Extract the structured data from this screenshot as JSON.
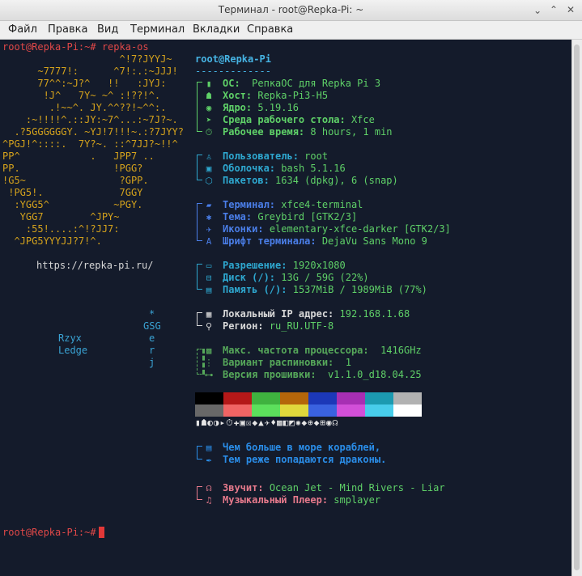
{
  "window": {
    "title": "Терминал - root@Repka-Pi: ~",
    "minimize": "⌃",
    "maximize": "⌃",
    "close": "✕"
  },
  "menu": [
    "Файл",
    "Правка",
    "Вид",
    "Терминал",
    "Вкладки",
    "Справка"
  ],
  "prompt": "root@Repka-Pi:~#",
  "command": "repka-os",
  "ascii_art": [
    "                    ^!7?JYYJ~",
    "      ~7777!:      ^7!:.:~JJJ!",
    "      77^^:~J?^   !!   :JYJ:",
    "       !J^   7Y~ ~^ :!??!^.",
    "        .!~~^. JY.^^??!~^^:.",
    "    :~!!!!^.::JY:~7^...:~7J?~.",
    "  .?5GGGGGGY. ~YJ!7!!!~.:?7JYY?",
    "^PGJ!^::::.  7Y?~. ::^7JJ?~!!^",
    "PP^            .   JPP7 ..",
    "PP.                !PGG?",
    "!G5~                ?GPP.",
    " !PG5!.             7GGY",
    "  :YGG5^           ~PGY.",
    "   YGG7        ^JPY~",
    "    :55!....:^!?JJ7:",
    "  ^JPG5YYYJJ?7!^."
  ],
  "url": "https://repka-pi.ru/",
  "left_labels": [
    "Rzyx",
    "Ledge"
  ],
  "left_vertical": [
    "*",
    "GSG",
    "e",
    "r",
    "j"
  ],
  "user_host": "root@Repka-Pi",
  "separator": "-------------",
  "groups": {
    "os": [
      {
        "label": "ОС:",
        "value": "РепкаОС для Repka Pi 3",
        "icon": "hdd-icon"
      },
      {
        "label": "Хост:",
        "value": "Repka-Pi3-H5",
        "icon": "penguin-icon"
      },
      {
        "label": "Ядро:",
        "value": "5.19.16",
        "icon": "kernel-icon"
      },
      {
        "label": "Среда рабочего стола:",
        "value": "Xfce",
        "icon": "mouse-icon"
      },
      {
        "label": "Рабочее время:",
        "value": "8 hours, 1 min",
        "icon": "timer-icon"
      }
    ],
    "user": [
      {
        "label": "Пользователь:",
        "value": "root",
        "icon": "user-icon"
      },
      {
        "label": "Оболочка:",
        "value": "bash 5.1.16",
        "icon": "shell-icon"
      },
      {
        "label": "Пакетов:",
        "value": "1634 (dpkg), 6 (snap)",
        "icon": "package-icon"
      }
    ],
    "term": [
      {
        "label": "Терминал:",
        "value": "xfce4-terminal",
        "icon": "terminal-icon"
      },
      {
        "label": "Тема:",
        "value": "Greybird [GTK2/3]",
        "icon": "theme-icon"
      },
      {
        "label": "Иконки:",
        "value": "elementary-xfce-darker [GTK2/3]",
        "icon": "icons-icon"
      },
      {
        "label": "Шрифт терминала:",
        "value": "DejaVu Sans Mono 9",
        "icon": "font-icon"
      }
    ],
    "disp": [
      {
        "label": "Разрешение:",
        "value": "1920x1080",
        "icon": "monitor-icon"
      },
      {
        "label": "Диск (/):",
        "value": "13G / 59G (22%)",
        "icon": "disk-icon"
      },
      {
        "label": "Память (/):",
        "value": "1537MiB / 1989MiB (77%)",
        "icon": "memory-icon"
      }
    ],
    "net": [
      {
        "label": "Локальный IP адрес:",
        "value": "192.168.1.68",
        "icon": "ip-icon"
      },
      {
        "label": "Регион:",
        "value": "ru_RU.UTF-8",
        "icon": "location-icon"
      }
    ],
    "cpu": [
      {
        "label": "Макс. частота процессора:",
        "value": " 1416GHz",
        "icon": "cpu-icon"
      },
      {
        "label": "Вариант распиновки:",
        "value": " 1",
        "icon": "pinout-icon"
      },
      {
        "label": "Версия прошивки:",
        "value": " v1.1.0_d18.04.25",
        "icon": "firmware-icon"
      }
    ],
    "quote": [
      {
        "label": "Чем больше в море кораблей,",
        "value": "",
        "icon": "scroll-icon"
      },
      {
        "label": "Тем реже попадаются драконы.",
        "value": "",
        "icon": "quill-icon"
      }
    ],
    "music": [
      {
        "label": "Звучит:",
        "value": "Ocean Jet - Mind Rivers - Liar",
        "icon": "headphones-icon"
      },
      {
        "label": "Музыкальный Плеер:",
        "value": "smplayer",
        "icon": "note-icon"
      }
    ]
  },
  "palette": {
    "row1": [
      "#000000",
      "#b41818",
      "#3fb23f",
      "#b4660a",
      "#1c38b8",
      "#a72fb3",
      "#1c9ab0",
      "#b2b2b2"
    ],
    "row2": [
      "#686868",
      "#f06464",
      "#5ce05c",
      "#e0d83c",
      "#3a62e0",
      "#d24fd8",
      "#48cdea",
      "#ffffff"
    ]
  },
  "icon_strip": "▮☗◐◑▸⏱✚▣☒◆▲✈♦▩◧◩✺◆⊕◆⊞◉☊"
}
